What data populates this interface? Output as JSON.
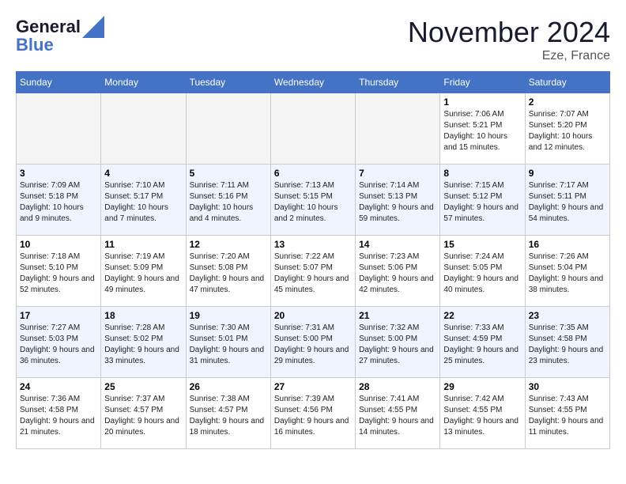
{
  "header": {
    "logo_line1": "General",
    "logo_line2": "Blue",
    "month": "November 2024",
    "location": "Eze, France"
  },
  "weekdays": [
    "Sunday",
    "Monday",
    "Tuesday",
    "Wednesday",
    "Thursday",
    "Friday",
    "Saturday"
  ],
  "weeks": [
    [
      {
        "day": "",
        "info": ""
      },
      {
        "day": "",
        "info": ""
      },
      {
        "day": "",
        "info": ""
      },
      {
        "day": "",
        "info": ""
      },
      {
        "day": "",
        "info": ""
      },
      {
        "day": "1",
        "info": "Sunrise: 7:06 AM\nSunset: 5:21 PM\nDaylight: 10 hours and 15 minutes."
      },
      {
        "day": "2",
        "info": "Sunrise: 7:07 AM\nSunset: 5:20 PM\nDaylight: 10 hours and 12 minutes."
      }
    ],
    [
      {
        "day": "3",
        "info": "Sunrise: 7:09 AM\nSunset: 5:18 PM\nDaylight: 10 hours and 9 minutes."
      },
      {
        "day": "4",
        "info": "Sunrise: 7:10 AM\nSunset: 5:17 PM\nDaylight: 10 hours and 7 minutes."
      },
      {
        "day": "5",
        "info": "Sunrise: 7:11 AM\nSunset: 5:16 PM\nDaylight: 10 hours and 4 minutes."
      },
      {
        "day": "6",
        "info": "Sunrise: 7:13 AM\nSunset: 5:15 PM\nDaylight: 10 hours and 2 minutes."
      },
      {
        "day": "7",
        "info": "Sunrise: 7:14 AM\nSunset: 5:13 PM\nDaylight: 9 hours and 59 minutes."
      },
      {
        "day": "8",
        "info": "Sunrise: 7:15 AM\nSunset: 5:12 PM\nDaylight: 9 hours and 57 minutes."
      },
      {
        "day": "9",
        "info": "Sunrise: 7:17 AM\nSunset: 5:11 PM\nDaylight: 9 hours and 54 minutes."
      }
    ],
    [
      {
        "day": "10",
        "info": "Sunrise: 7:18 AM\nSunset: 5:10 PM\nDaylight: 9 hours and 52 minutes."
      },
      {
        "day": "11",
        "info": "Sunrise: 7:19 AM\nSunset: 5:09 PM\nDaylight: 9 hours and 49 minutes."
      },
      {
        "day": "12",
        "info": "Sunrise: 7:20 AM\nSunset: 5:08 PM\nDaylight: 9 hours and 47 minutes."
      },
      {
        "day": "13",
        "info": "Sunrise: 7:22 AM\nSunset: 5:07 PM\nDaylight: 9 hours and 45 minutes."
      },
      {
        "day": "14",
        "info": "Sunrise: 7:23 AM\nSunset: 5:06 PM\nDaylight: 9 hours and 42 minutes."
      },
      {
        "day": "15",
        "info": "Sunrise: 7:24 AM\nSunset: 5:05 PM\nDaylight: 9 hours and 40 minutes."
      },
      {
        "day": "16",
        "info": "Sunrise: 7:26 AM\nSunset: 5:04 PM\nDaylight: 9 hours and 38 minutes."
      }
    ],
    [
      {
        "day": "17",
        "info": "Sunrise: 7:27 AM\nSunset: 5:03 PM\nDaylight: 9 hours and 36 minutes."
      },
      {
        "day": "18",
        "info": "Sunrise: 7:28 AM\nSunset: 5:02 PM\nDaylight: 9 hours and 33 minutes."
      },
      {
        "day": "19",
        "info": "Sunrise: 7:30 AM\nSunset: 5:01 PM\nDaylight: 9 hours and 31 minutes."
      },
      {
        "day": "20",
        "info": "Sunrise: 7:31 AM\nSunset: 5:00 PM\nDaylight: 9 hours and 29 minutes."
      },
      {
        "day": "21",
        "info": "Sunrise: 7:32 AM\nSunset: 5:00 PM\nDaylight: 9 hours and 27 minutes."
      },
      {
        "day": "22",
        "info": "Sunrise: 7:33 AM\nSunset: 4:59 PM\nDaylight: 9 hours and 25 minutes."
      },
      {
        "day": "23",
        "info": "Sunrise: 7:35 AM\nSunset: 4:58 PM\nDaylight: 9 hours and 23 minutes."
      }
    ],
    [
      {
        "day": "24",
        "info": "Sunrise: 7:36 AM\nSunset: 4:58 PM\nDaylight: 9 hours and 21 minutes."
      },
      {
        "day": "25",
        "info": "Sunrise: 7:37 AM\nSunset: 4:57 PM\nDaylight: 9 hours and 20 minutes."
      },
      {
        "day": "26",
        "info": "Sunrise: 7:38 AM\nSunset: 4:57 PM\nDaylight: 9 hours and 18 minutes."
      },
      {
        "day": "27",
        "info": "Sunrise: 7:39 AM\nSunset: 4:56 PM\nDaylight: 9 hours and 16 minutes."
      },
      {
        "day": "28",
        "info": "Sunrise: 7:41 AM\nSunset: 4:55 PM\nDaylight: 9 hours and 14 minutes."
      },
      {
        "day": "29",
        "info": "Sunrise: 7:42 AM\nSunset: 4:55 PM\nDaylight: 9 hours and 13 minutes."
      },
      {
        "day": "30",
        "info": "Sunrise: 7:43 AM\nSunset: 4:55 PM\nDaylight: 9 hours and 11 minutes."
      }
    ]
  ]
}
